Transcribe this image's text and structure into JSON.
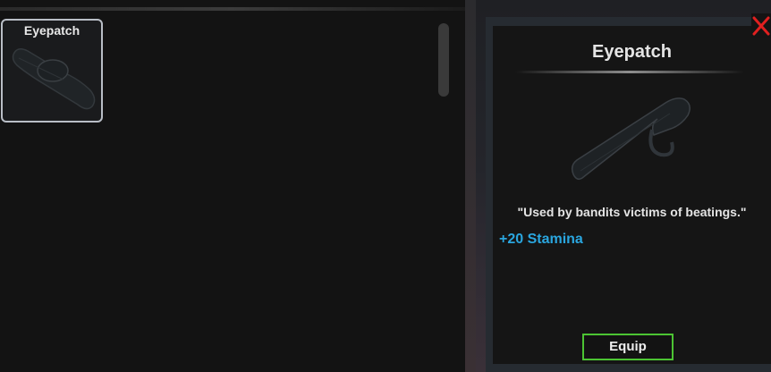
{
  "inventory": {
    "items": [
      {
        "label": "Eyepatch",
        "icon": "eyepatch-icon"
      }
    ]
  },
  "detail": {
    "title": "Eyepatch",
    "preview_icon": "eyepatch-icon",
    "description": "\"Used by bandits victims of beatings.\"",
    "stat": "+20 Stamina",
    "equip_label": "Equip"
  },
  "close_icon": "close-icon",
  "colors": {
    "stat": "#2aa6df",
    "equip_border": "#4cc433",
    "close": "#e02020"
  }
}
